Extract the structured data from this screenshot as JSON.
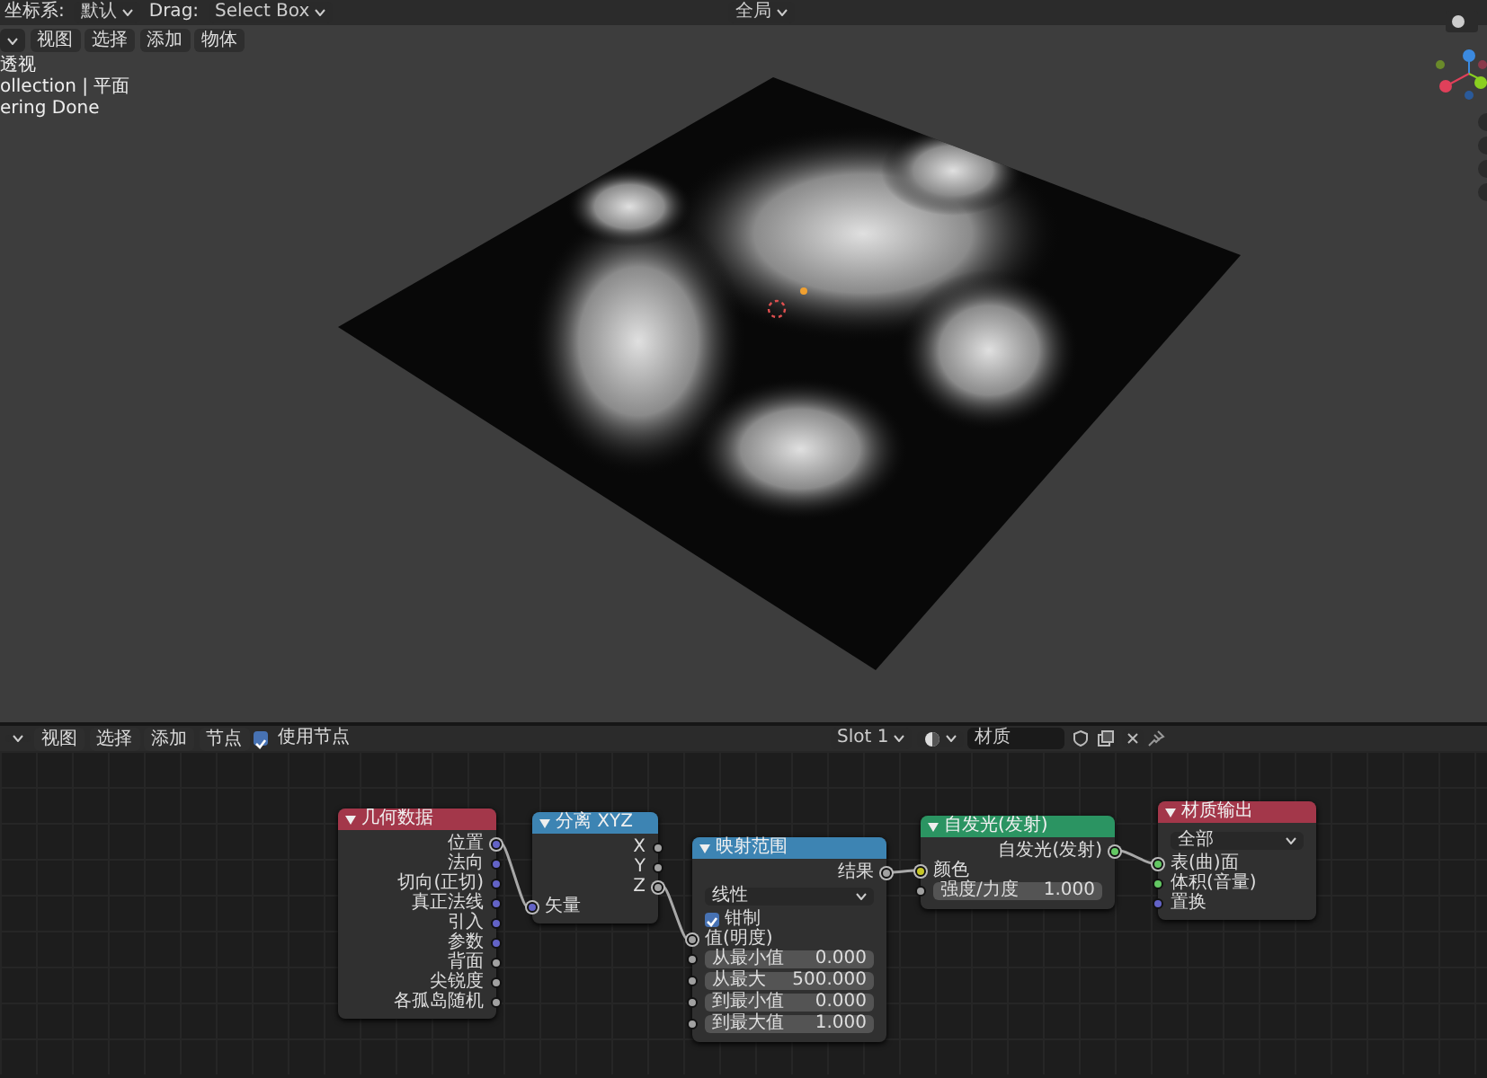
{
  "top_bar": [
    {
      "kind": "label",
      "text": "坐标系:"
    },
    {
      "kind": "dropdown",
      "text": "默认"
    },
    {
      "kind": "label",
      "text": "Drag:"
    },
    {
      "kind": "dropdown",
      "text": "Select Box"
    },
    {
      "kind": "spacer"
    },
    {
      "kind": "dropdown",
      "text": "全局"
    }
  ],
  "viewport": {
    "menu": [
      "视图",
      "选择",
      "添加",
      "物体"
    ],
    "overlay_text": [
      "透视",
      "ollection | 平面",
      "ering Done"
    ]
  },
  "node_editor": {
    "menu": [
      "视图",
      "选择",
      "添加",
      "节点"
    ],
    "use_nodes": {
      "label": "使用节点",
      "checked": true
    },
    "slot": "Slot 1",
    "material": "材质",
    "nodes": [
      {
        "title": "几何数据",
        "color": "#a3374a",
        "rows": [
          {
            "kind": "output",
            "label": "位置",
            "color": "#6363c7",
            "linked": true
          },
          {
            "kind": "output",
            "label": "法向",
            "color": "#6363c7",
            "linked": false
          },
          {
            "kind": "output",
            "label": "切向(正切)",
            "color": "#6363c7",
            "linked": false
          },
          {
            "kind": "output",
            "label": "真正法线",
            "color": "#6363c7",
            "linked": false
          },
          {
            "kind": "output",
            "label": "引入",
            "color": "#6363c7",
            "linked": false
          },
          {
            "kind": "output",
            "label": "参数",
            "color": "#6363c7",
            "linked": false
          },
          {
            "kind": "output",
            "label": "背面",
            "color": "#a1a1a1",
            "linked": false
          },
          {
            "kind": "output",
            "label": "尖锐度",
            "color": "#a1a1a1",
            "linked": false
          },
          {
            "kind": "output",
            "label": "各孤岛随机",
            "color": "#a1a1a1",
            "linked": false
          }
        ]
      },
      {
        "title": "分离 XYZ",
        "color": "#3d84b3",
        "rows": [
          {
            "kind": "output",
            "label": "X",
            "color": "#a1a1a1",
            "linked": false
          },
          {
            "kind": "output",
            "label": "Y",
            "color": "#a1a1a1",
            "linked": false
          },
          {
            "kind": "output",
            "label": "Z",
            "color": "#a1a1a1",
            "linked": true
          },
          {
            "kind": "input",
            "label": "矢量",
            "color": "#6363c7",
            "linked": true
          }
        ]
      },
      {
        "title": "映射范围",
        "color": "#3d84b3",
        "rows": [
          {
            "kind": "output",
            "label": "结果",
            "color": "#a1a1a1",
            "linked": true
          },
          {
            "kind": "dropdown",
            "label": "线性"
          },
          {
            "kind": "checkbox",
            "label": "钳制",
            "checked": true
          },
          {
            "kind": "input",
            "label": "值(明度)",
            "color": "#a1a1a1",
            "linked": true
          },
          {
            "kind": "field",
            "label": "从最小值",
            "value": "0.000",
            "color": "#a1a1a1",
            "linked": false
          },
          {
            "kind": "field",
            "label": "从最大",
            "value": "500.000",
            "color": "#a1a1a1",
            "linked": false
          },
          {
            "kind": "field",
            "label": "到最小值",
            "value": "0.000",
            "color": "#a1a1a1",
            "linked": false
          },
          {
            "kind": "field",
            "label": "到最大值",
            "value": "1.000",
            "color": "#a1a1a1",
            "linked": false
          }
        ]
      },
      {
        "title": "自发光(发射)",
        "color": "#2b9462",
        "rows": [
          {
            "kind": "output",
            "label": "自发光(发射)",
            "color": "#63c763",
            "linked": true
          },
          {
            "kind": "input",
            "label": "颜色",
            "color": "#c7c729",
            "linked": true
          },
          {
            "kind": "field",
            "label": "强度/力度",
            "value": "1.000",
            "color": "#a1a1a1",
            "linked": false
          }
        ]
      },
      {
        "title": "材质输出",
        "color": "#a3374a",
        "rows": [
          {
            "kind": "dropdown",
            "label": "全部"
          },
          {
            "kind": "input",
            "label": "表(曲)面",
            "color": "#63c763",
            "linked": true
          },
          {
            "kind": "input",
            "label": "体积(音量)",
            "color": "#63c763",
            "linked": false
          },
          {
            "kind": "input",
            "label": "置换",
            "color": "#6363c7",
            "linked": false
          }
        ]
      }
    ]
  }
}
